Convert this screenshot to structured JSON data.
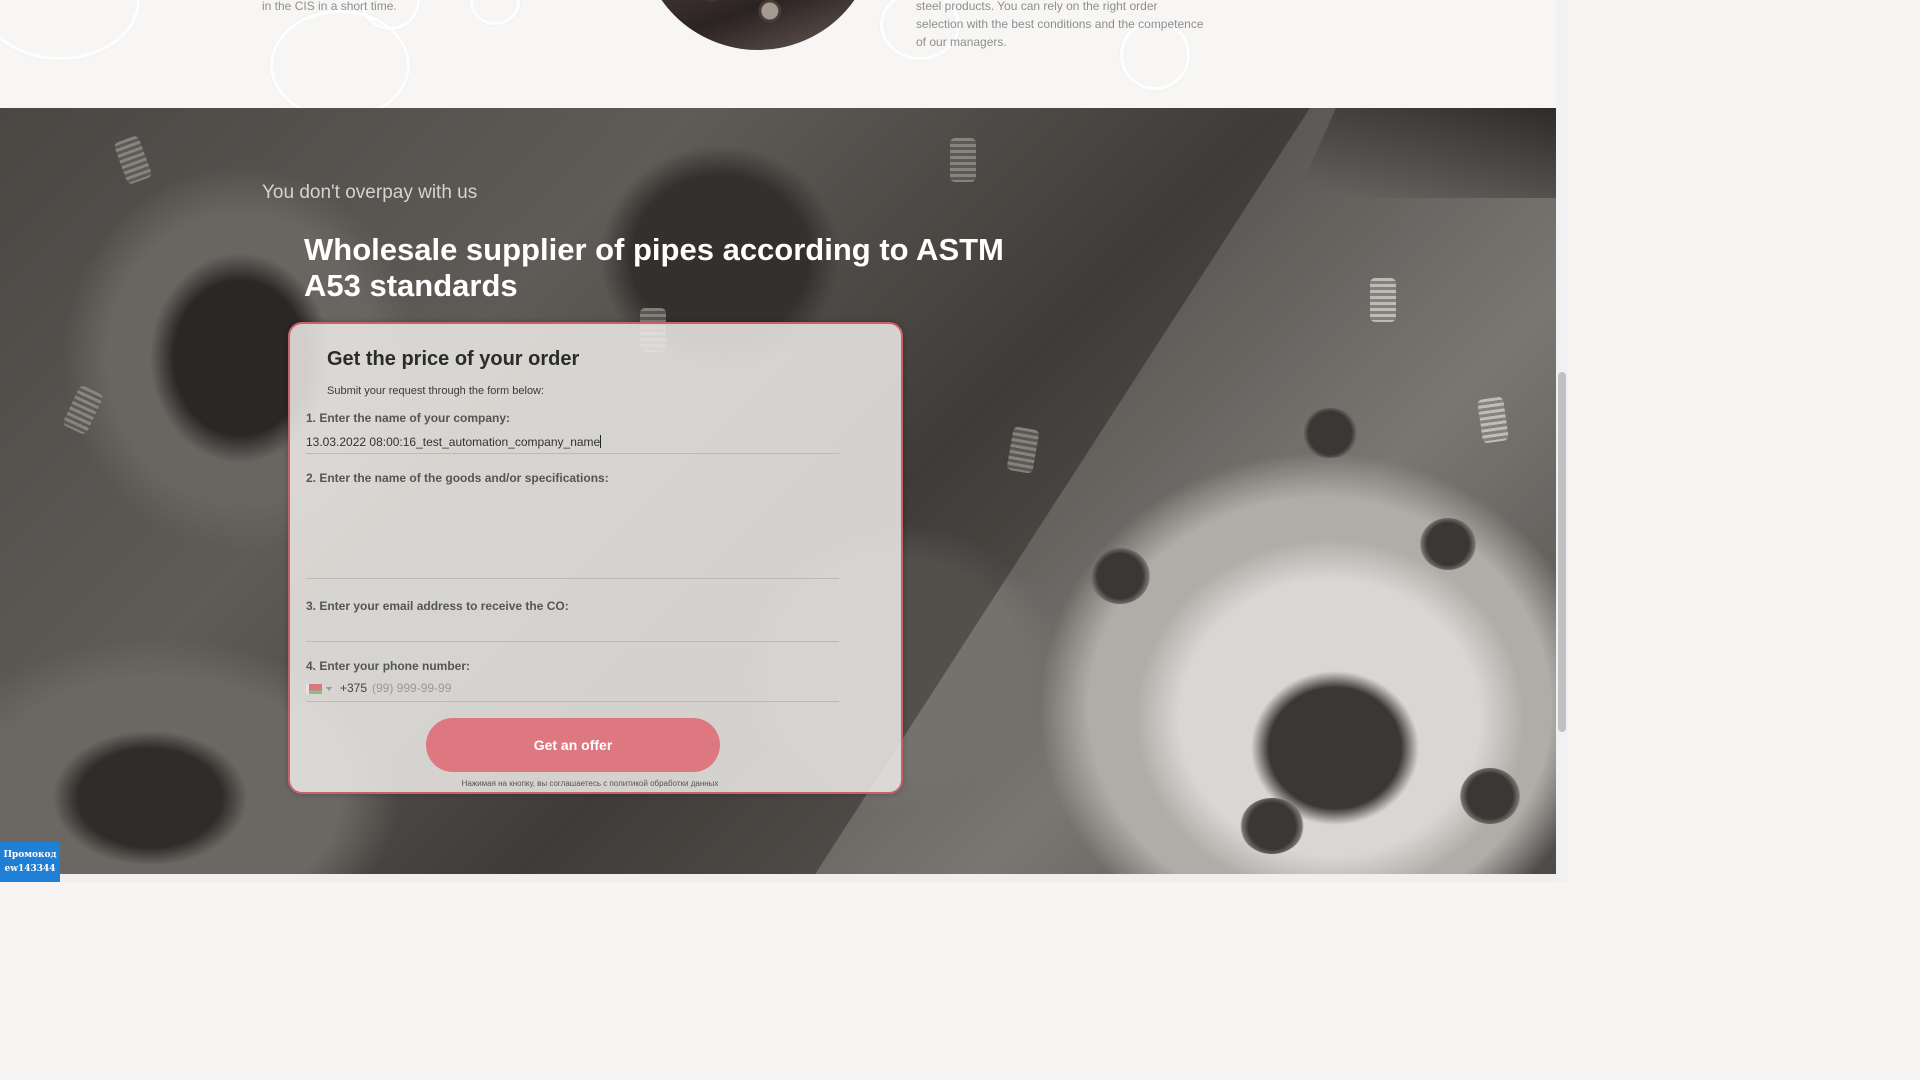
{
  "top": {
    "left_text": "in the CIS in a short time.",
    "right_text": "steel products. You can rely on the right order selection with the best conditions and the competence of our managers."
  },
  "hero": {
    "subtitle": "You don't overpay with us",
    "headline": "Wholesale supplier of pipes according to ASTM A53 standards"
  },
  "form": {
    "title": "Get the price of your order",
    "subtitle": "Submit your request through the form below:",
    "company_label": "1. Enter the name of your company:",
    "company_value": "13.03.2022 08:00:16_test_automation_company_name",
    "goods_label": "2. Enter the name of the goods and/or specifications:",
    "goods_value": "",
    "email_label": "3. Enter your email address to receive the CO:",
    "email_value": "",
    "phone_label": "4. Enter your phone number:",
    "phone_code": "+375",
    "phone_placeholder": "(99) 999-99-99",
    "submit_label": "Get an offer",
    "consent": "Нажимая на кнопку, вы соглашаетесь с политикой обработки данных"
  },
  "promo": {
    "line1": "Промокод",
    "line2": "ew143344"
  },
  "colors": {
    "accent": "#dd7880",
    "card_border": "#c8626a",
    "promo_bg": "#1f7fd4"
  },
  "icons": {
    "flag": "belarus-flag-icon",
    "dropdown": "chevron-down-icon"
  }
}
